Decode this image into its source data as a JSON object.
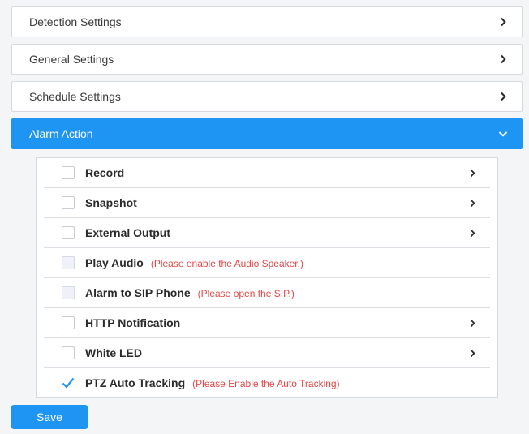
{
  "sections": [
    {
      "label": "Detection Settings",
      "expanded": false
    },
    {
      "label": "General Settings",
      "expanded": false
    },
    {
      "label": "Schedule Settings",
      "expanded": false
    },
    {
      "label": "Alarm Action",
      "expanded": true
    }
  ],
  "alarm_actions": [
    {
      "label": "Record",
      "note": "",
      "checked": false,
      "disabled": false,
      "expandable": true
    },
    {
      "label": "Snapshot",
      "note": "",
      "checked": false,
      "disabled": false,
      "expandable": true
    },
    {
      "label": "External Output",
      "note": "",
      "checked": false,
      "disabled": false,
      "expandable": true
    },
    {
      "label": "Play Audio",
      "note": "(Please enable the Audio Speaker.)",
      "checked": false,
      "disabled": true,
      "expandable": false
    },
    {
      "label": "Alarm to SIP Phone",
      "note": "(Please open the SIP.)",
      "checked": false,
      "disabled": true,
      "expandable": false
    },
    {
      "label": "HTTP Notification",
      "note": "",
      "checked": false,
      "disabled": false,
      "expandable": true
    },
    {
      "label": "White LED",
      "note": "",
      "checked": false,
      "disabled": false,
      "expandable": true
    },
    {
      "label": "PTZ Auto Tracking",
      "note": "(Please Enable the Auto Tracking)",
      "checked": true,
      "disabled": false,
      "expandable": false
    }
  ],
  "save_label": "Save",
  "colors": {
    "accent": "#1e95f2",
    "note_red": "#e84545",
    "border": "#d6d9de"
  },
  "icons": {
    "collapsed": "chevron-right-icon",
    "expanded": "chevron-down-icon",
    "checked": "checkmark-icon"
  }
}
